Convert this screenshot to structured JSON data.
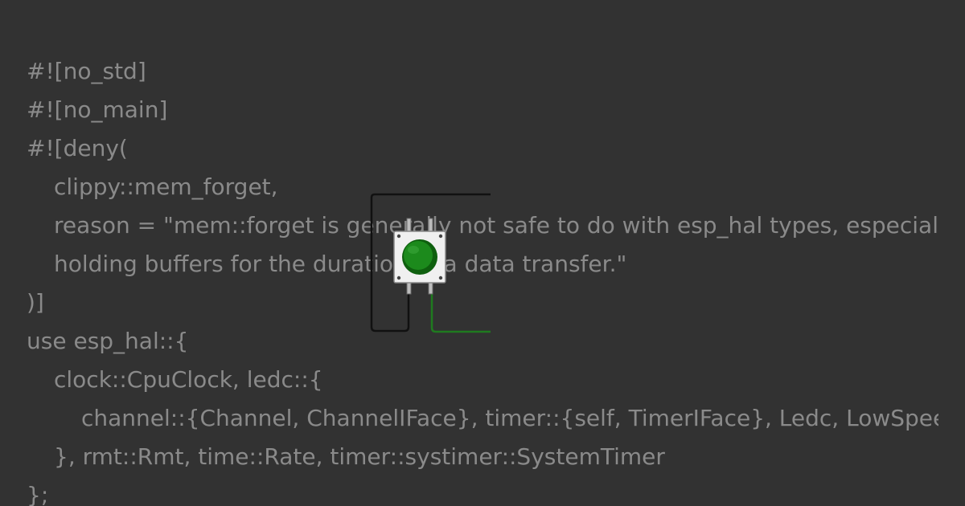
{
  "code": {
    "lines": [
      {
        "text": "#![no_std]",
        "indent": 0
      },
      {
        "text": "#![no_main]",
        "indent": 0
      },
      {
        "text": "#![deny(",
        "indent": 0
      },
      {
        "text": "clippy::mem_forget,",
        "indent": 1
      },
      {
        "text": "reason = \"mem::forget is generally not safe to do with esp_hal types, especially those",
        "indent": 1
      },
      {
        "text": "holding buffers for the duration of a data transfer.\"",
        "indent": 1
      },
      {
        "text": ")]",
        "indent": 0
      },
      {
        "text": "use esp_hal::{",
        "indent": 0
      },
      {
        "text": "clock::CpuClock, ledc::{",
        "indent": 1
      },
      {
        "text": "channel::{Channel, ChannelIFace}, timer::{self, TimerIFace}, Ledc, LowSpeed",
        "indent": 2
      },
      {
        "text": "}, rmt::Rmt, time::Rate, timer::systimer::SystemTimer",
        "indent": 1
      },
      {
        "text": "};",
        "indent": 0
      }
    ]
  },
  "colors": {
    "background": "#323232",
    "code_text": "#8a8a8a",
    "button_cap": "#1c8a1c",
    "button_body": "#f0f0f0",
    "wire_left": "#111111",
    "wire_right": "#1f7a1f"
  },
  "icons": {
    "push_button": "green-push-button-icon"
  }
}
